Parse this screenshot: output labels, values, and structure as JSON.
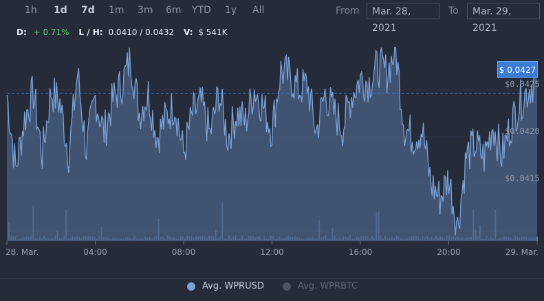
{
  "range_buttons": [
    {
      "label": "1h",
      "selected": false
    },
    {
      "label": "1d",
      "selected": true
    },
    {
      "label": "7d",
      "selected": true
    },
    {
      "label": "1m",
      "selected": false
    },
    {
      "label": "3m",
      "selected": false
    },
    {
      "label": "6m",
      "selected": false
    },
    {
      "label": "YTD",
      "selected": false
    },
    {
      "label": "1y",
      "selected": false
    },
    {
      "label": "All",
      "selected": false
    }
  ],
  "date_range": {
    "from_label": "From",
    "from_value": "Mar. 28, 2021",
    "to_label": "To",
    "to_value": "Mar. 29, 2021"
  },
  "stats": {
    "d_label": "D:",
    "d_value": "+ 0.71%",
    "lh_label": "L / H:",
    "lh_value": "0.0410 / 0.0432",
    "v_label": "V:",
    "v_value": "$ 541K"
  },
  "current_price_tag": "$ 0.0427",
  "colors": {
    "background": "#262b3a",
    "area_line": "#7ba3d8",
    "area_fill": "#4a6186",
    "positive": "#53d769",
    "price_tag": "#3a7bd5",
    "legend_active": "#7ba3d8",
    "legend_inactive": "#4d535f"
  },
  "chart_data": {
    "type": "area",
    "x_ticks": [
      "28. Mar.",
      "04:00",
      "08:00",
      "12:00",
      "16:00",
      "20:00",
      "29. Mar."
    ],
    "y_ticks": [
      "$0.0415",
      "$0.0420",
      "$0.0425"
    ],
    "y_tick_values": [
      0.0415,
      0.042,
      0.0425
    ],
    "ylim": [
      0.0409,
      0.043
    ],
    "current_price": 0.0427,
    "series": [
      {
        "name": "Avg. WPRUSD",
        "visible": true
      },
      {
        "name": "Avg. WPRBTC",
        "visible": false
      }
    ],
    "price_points": [
      [
        0.0,
        0.04245
      ],
      [
        0.4,
        0.04166
      ],
      [
        0.8,
        0.04219
      ],
      [
        1.2,
        0.04247
      ],
      [
        1.6,
        0.04181
      ],
      [
        2.0,
        0.04248
      ],
      [
        2.4,
        0.04236
      ],
      [
        2.8,
        0.04182
      ],
      [
        3.2,
        0.04268
      ],
      [
        3.6,
        0.04186
      ],
      [
        4.0,
        0.04242
      ],
      [
        4.4,
        0.04204
      ],
      [
        4.8,
        0.04239
      ],
      [
        5.2,
        0.04256
      ],
      [
        5.6,
        0.04283
      ],
      [
        6.0,
        0.04226
      ],
      [
        6.4,
        0.04246
      ],
      [
        6.8,
        0.042
      ],
      [
        7.2,
        0.0422
      ],
      [
        7.6,
        0.04235
      ],
      [
        8.0,
        0.04182
      ],
      [
        8.4,
        0.04224
      ],
      [
        8.8,
        0.04235
      ],
      [
        9.2,
        0.04202
      ],
      [
        9.6,
        0.04247
      ],
      [
        10.0,
        0.04199
      ],
      [
        10.4,
        0.04225
      ],
      [
        10.8,
        0.04216
      ],
      [
        11.2,
        0.04251
      ],
      [
        11.6,
        0.04232
      ],
      [
        12.0,
        0.04208
      ],
      [
        12.4,
        0.0427
      ],
      [
        12.8,
        0.04264
      ],
      [
        13.2,
        0.0425
      ],
      [
        13.6,
        0.04256
      ],
      [
        14.0,
        0.04205
      ],
      [
        14.4,
        0.04246
      ],
      [
        14.8,
        0.04226
      ],
      [
        15.2,
        0.0421
      ],
      [
        15.6,
        0.04244
      ],
      [
        16.0,
        0.04262
      ],
      [
        16.4,
        0.04258
      ],
      [
        16.8,
        0.04275
      ],
      [
        17.2,
        0.04268
      ],
      [
        17.6,
        0.04292
      ],
      [
        18.0,
        0.0421
      ],
      [
        18.4,
        0.042
      ],
      [
        18.8,
        0.04208
      ],
      [
        19.2,
        0.0415
      ],
      [
        19.6,
        0.04135
      ],
      [
        20.0,
        0.04157
      ],
      [
        20.4,
        0.04105
      ],
      [
        20.8,
        0.0418
      ],
      [
        21.2,
        0.04192
      ],
      [
        21.6,
        0.04178
      ],
      [
        22.0,
        0.04213
      ],
      [
        22.4,
        0.0418
      ],
      [
        22.8,
        0.04212
      ],
      [
        23.2,
        0.04237
      ],
      [
        23.6,
        0.0425
      ],
      [
        24.0,
        0.04265
      ]
    ]
  },
  "legend": [
    {
      "label": "Avg. WPRUSD",
      "active": true
    },
    {
      "label": "Avg. WPRBTC",
      "active": false
    }
  ]
}
